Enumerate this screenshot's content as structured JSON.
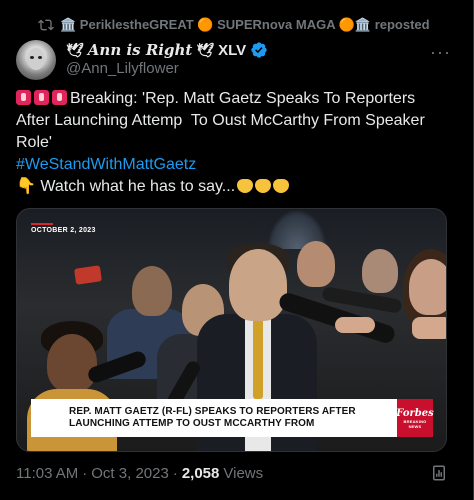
{
  "repost": {
    "text": "🏛️ PeriklestheGREAT 🟠 SUPERnova MAGA 🟠🏛️ reposted",
    "user_name": "PeriklestheGREAT",
    "suffix": "SUPERnova MAGA",
    "label": "reposted"
  },
  "author": {
    "display_name": "Ann is Right",
    "badge_text": "XLV",
    "handle": "@Ann_Lilyflower"
  },
  "tweet": {
    "line1_suffix": "Breaking: 'Rep. Matt Gaetz Speaks To Reporters",
    "line2": "After Launching Attemp  To Oust McCarthy From Speaker",
    "line3": "Role'",
    "hashtag": "#WeStandWithMattGaetz",
    "line5": "Watch what he has to say..."
  },
  "media": {
    "date_label": "OCTOBER 2, 2023",
    "lower_third_line1": "REP. MATT GAETZ (R-FL) SPEAKS TO REPORTERS AFTER",
    "lower_third_line2": "LAUNCHING ATTEMP TO OUST MCCARTHY FROM",
    "logo_name": "Forbes",
    "logo_sub": "BREAKING NEWS"
  },
  "meta": {
    "time": "11:03 AM",
    "separator": "·",
    "date": "Oct 3, 2023",
    "separator2": "·",
    "views_count": "2,058",
    "views_label": "Views"
  },
  "colors": {
    "background": "#000000",
    "text": "#e7e9ea",
    "muted": "#71767b",
    "link": "#1d9bf0",
    "verified": "#1d9bf0",
    "forbes_red": "#c8102e"
  },
  "icons": [
    "repost-icon",
    "dove-icon",
    "verified-icon",
    "more-icon",
    "siren-icon",
    "pointing-down-icon",
    "clap-icon",
    "analytics-icon"
  ]
}
